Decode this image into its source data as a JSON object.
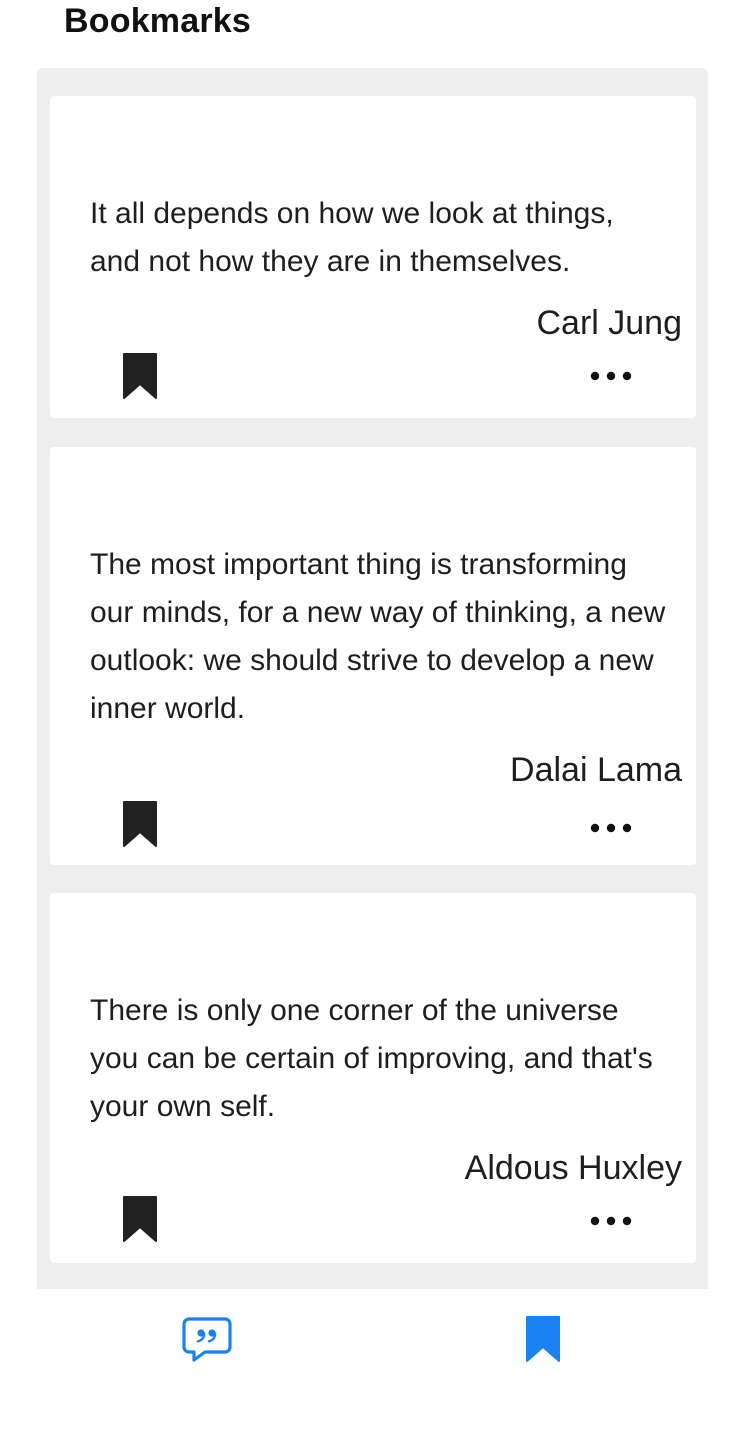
{
  "header": {
    "title": "Bookmarks"
  },
  "quotes": [
    {
      "text": "It all depends on how we look at things, and not how they are in themselves.",
      "author": "Carl Jung",
      "bookmarked": true
    },
    {
      "text": "The most important thing is transforming our minds, for a new way of thinking, a new outlook: we should strive to develop a new inner world.",
      "author": "Dalai Lama",
      "bookmarked": true
    },
    {
      "text": "There is only one corner of the universe you can be certain of improving, and that's your own self.",
      "author": "Aldous Huxley",
      "bookmarked": true
    }
  ],
  "icons": {
    "card_bookmark": "bookmark-filled-icon",
    "card_more": "more-horizontal-icon",
    "nav_quotes": "quote-bubble-icon",
    "nav_bookmarks": "bookmark-filled-icon"
  },
  "colors": {
    "accent": "#1a82f0",
    "icon_dark": "#222222",
    "panel_bg": "#eeeeee",
    "card_bg": "#ffffff"
  },
  "bottom_nav": {
    "active_tab": "bookmarks"
  }
}
